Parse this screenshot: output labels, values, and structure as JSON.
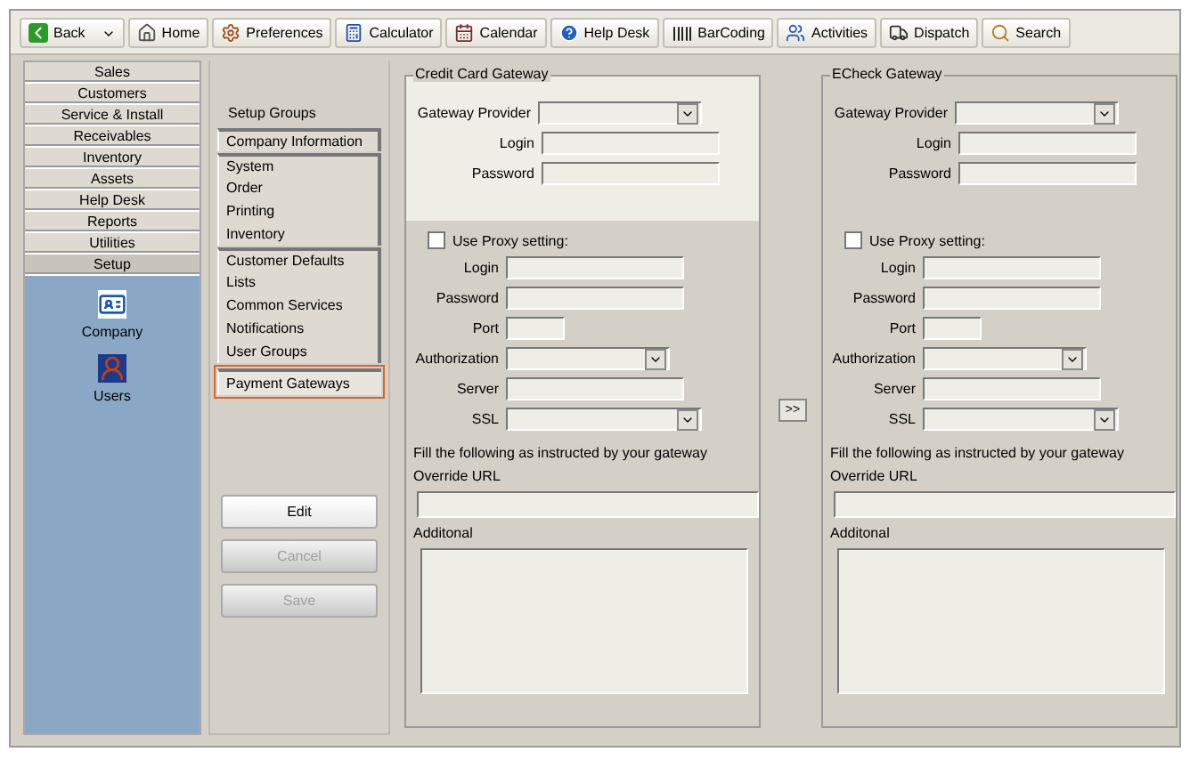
{
  "toolbar": [
    {
      "label": "Back",
      "kind": "back"
    },
    {
      "label": "Home",
      "kind": "home"
    },
    {
      "label": "Preferences",
      "kind": "preferences"
    },
    {
      "label": "Calculator",
      "kind": "calculator"
    },
    {
      "label": "Calendar",
      "kind": "calendar"
    },
    {
      "label": "Help Desk",
      "kind": "help"
    },
    {
      "label": "BarCoding",
      "kind": "barcode"
    },
    {
      "label": "Activities",
      "kind": "activities"
    },
    {
      "label": "Dispatch",
      "kind": "dispatch"
    },
    {
      "label": "Search",
      "kind": "search"
    }
  ],
  "nav": [
    {
      "label": "Sales",
      "selected": false
    },
    {
      "label": "Customers",
      "selected": false
    },
    {
      "label": "Service & Install",
      "selected": false
    },
    {
      "label": "Receivables",
      "selected": false
    },
    {
      "label": "Inventory",
      "selected": false
    },
    {
      "label": "Assets",
      "selected": false
    },
    {
      "label": "Help Desk",
      "selected": false
    },
    {
      "label": "Reports",
      "selected": false
    },
    {
      "label": "Utilities",
      "selected": false
    },
    {
      "label": "Setup",
      "selected": true
    }
  ],
  "nav_shortcuts": [
    {
      "label": "Company",
      "kind": "company"
    },
    {
      "label": "Users",
      "kind": "users"
    }
  ],
  "setup_groups": {
    "title": "Setup Groups",
    "items": [
      {
        "label": "Company Information",
        "selected": false,
        "group_start": true
      },
      {
        "label": "System",
        "selected": false,
        "group_start": true
      },
      {
        "label": "Order",
        "selected": false,
        "group_start": false
      },
      {
        "label": "Printing",
        "selected": false,
        "group_start": false
      },
      {
        "label": "Inventory",
        "selected": false,
        "group_start": false
      },
      {
        "label": "Customer Defaults",
        "selected": false,
        "group_start": true
      },
      {
        "label": "Lists",
        "selected": false,
        "group_start": false
      },
      {
        "label": "Common Services",
        "selected": false,
        "group_start": false
      },
      {
        "label": "Notifications",
        "selected": false,
        "group_start": false
      },
      {
        "label": "User Groups",
        "selected": false,
        "group_start": false
      },
      {
        "label": "Payment Gateways",
        "selected": true,
        "group_start": true
      }
    ]
  },
  "actions": [
    {
      "label": "Edit",
      "disabled": false
    },
    {
      "label": "Cancel",
      "disabled": true
    },
    {
      "label": "Save",
      "disabled": true
    }
  ],
  "copy_button": ">>",
  "gateways": [
    {
      "title": "Credit Card Gateway",
      "focused": true,
      "fields": [
        {
          "label": "Gateway Provider",
          "kind": "select"
        },
        {
          "label": "Login",
          "kind": "text"
        },
        {
          "label": "Password",
          "kind": "text"
        }
      ],
      "proxy": {
        "label": "Use Proxy setting:",
        "checked": false
      },
      "proxy_fields": [
        {
          "label": "Login",
          "kind": "text"
        },
        {
          "label": "Password",
          "kind": "text"
        },
        {
          "label": "Port",
          "kind": "short"
        },
        {
          "label": "Authorization",
          "kind": "select"
        },
        {
          "label": "Server",
          "kind": "text"
        },
        {
          "label": "SSL",
          "kind": "wide_select"
        }
      ],
      "instruction": "Fill the following as instructed by your gateway",
      "override_url": "Override URL",
      "additional": "Additonal"
    },
    {
      "title": "ECheck Gateway",
      "focused": false,
      "fields": [
        {
          "label": "Gateway Provider",
          "kind": "select"
        },
        {
          "label": "Login",
          "kind": "text"
        },
        {
          "label": "Password",
          "kind": "text"
        }
      ],
      "proxy": {
        "label": "Use Proxy setting:",
        "checked": false
      },
      "proxy_fields": [
        {
          "label": "Login",
          "kind": "text"
        },
        {
          "label": "Password",
          "kind": "text"
        },
        {
          "label": "Port",
          "kind": "short"
        },
        {
          "label": "Authorization",
          "kind": "select"
        },
        {
          "label": "Server",
          "kind": "text"
        },
        {
          "label": "SSL",
          "kind": "wide_select"
        }
      ],
      "instruction": "Fill the following as instructed by your gateway",
      "override_url": "Override URL",
      "additional": "Additonal"
    }
  ]
}
